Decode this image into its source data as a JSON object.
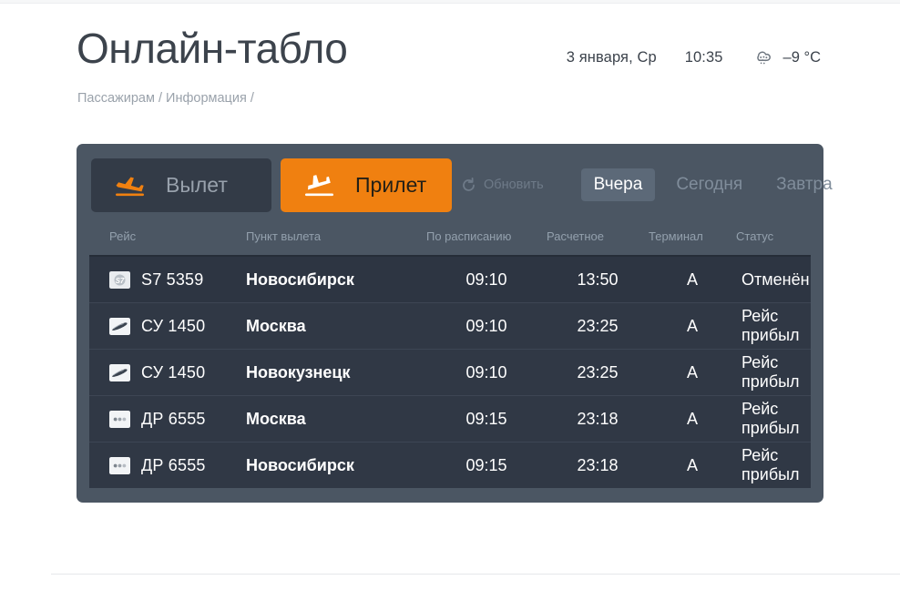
{
  "header": {
    "title": "Онлайн-табло",
    "breadcrumb": "Пассажирам / Информация /",
    "date": "3 января, Ср",
    "time": "10:35",
    "temperature": "–9 °C",
    "weather_icon": "snow-cloud-icon"
  },
  "tabs": {
    "departure": {
      "label": "Вылет",
      "icon": "plane-takeoff-icon",
      "active": false
    },
    "arrival": {
      "label": "Прилет",
      "icon": "plane-landing-icon",
      "active": true
    }
  },
  "controls": {
    "refresh": {
      "label": "Обновить",
      "icon": "refresh-icon"
    },
    "days": [
      {
        "label": "Вчера",
        "active": true
      },
      {
        "label": "Сегодня",
        "active": false
      },
      {
        "label": "Завтра",
        "active": false
      }
    ]
  },
  "table": {
    "columns": [
      "Рейс",
      "Пункт вылета",
      "По расписанию",
      "Расчетное",
      "Терминал",
      "Статус"
    ],
    "rows": [
      {
        "logo": "s7-logo-icon",
        "flight": "S7 5359",
        "point": "Новосибирск",
        "scheduled": "09:10",
        "estimated": "13:50",
        "terminal": "A",
        "status": "Отменён",
        "status_state": "cancelled"
      },
      {
        "logo": "aeroflot-logo-icon",
        "flight": "СУ 1450",
        "point": "Москва",
        "scheduled": "09:10",
        "estimated": "23:25",
        "terminal": "A",
        "status": "Рейс прибыл",
        "status_state": "arrived"
      },
      {
        "logo": "aeroflot-logo-icon",
        "flight": "СУ 1450",
        "point": "Новокузнецк",
        "scheduled": "09:10",
        "estimated": "23:25",
        "terminal": "A",
        "status": "Рейс прибыл",
        "status_state": "arrived"
      },
      {
        "logo": "dots-logo-icon",
        "flight": "ДР 6555",
        "point": "Москва",
        "scheduled": "09:15",
        "estimated": "23:18",
        "terminal": "A",
        "status": "Рейс прибыл",
        "status_state": "arrived"
      },
      {
        "logo": "dots-logo-icon",
        "flight": "ДР 6555",
        "point": "Новосибирск",
        "scheduled": "09:15",
        "estimated": "23:18",
        "terminal": "A",
        "status": "Рейс прибыл",
        "status_state": "arrived"
      }
    ]
  },
  "colors": {
    "accent_orange": "#f08010",
    "panel": "#4b5663",
    "row": "#303845",
    "status_cancelled": "#e06a5c"
  }
}
